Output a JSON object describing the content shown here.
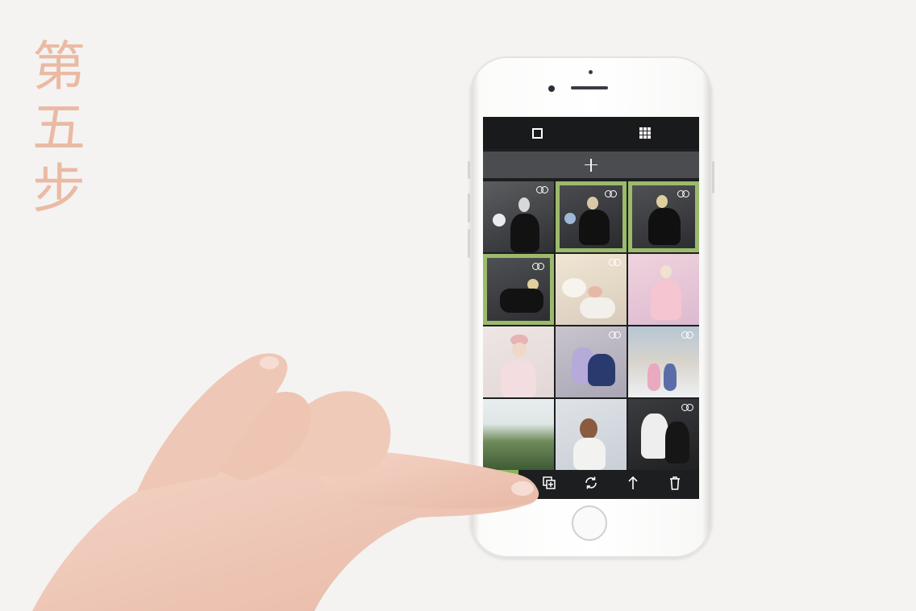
{
  "step_label": [
    "第",
    "五",
    "步"
  ],
  "colors": {
    "background": "#f4f3f1",
    "step_text": "#eabaa4",
    "selection": "#9cba6c",
    "toolbar_accent": "#8db45a"
  },
  "app": {
    "topbar": {
      "left_icon": "single-view-icon",
      "right_icon": "grid-view-icon"
    },
    "addbar_icon": "plus-icon",
    "tiles": [
      {
        "scene": "dark-studio-portrait-with-globe",
        "selected": false,
        "live": true
      },
      {
        "scene": "dark-studio-portrait-with-globe",
        "selected": true,
        "live": true
      },
      {
        "scene": "dark-studio-portrait-sunglasses",
        "selected": true,
        "live": true
      },
      {
        "scene": "dark-studio-portrait-lying",
        "selected": true,
        "live": true
      },
      {
        "scene": "pastel-portrait-lying",
        "selected": false,
        "live": true
      },
      {
        "scene": "pink-pastel-portrait",
        "selected": false,
        "live": false
      },
      {
        "scene": "pastel-portrait-headscarf",
        "selected": false,
        "live": false
      },
      {
        "scene": "couple-portrait-outdoors",
        "selected": false,
        "live": true
      },
      {
        "scene": "snowy-street-couple",
        "selected": false,
        "live": true
      },
      {
        "scene": "green-hills-landscape",
        "selected": false,
        "live": false
      },
      {
        "scene": "windblown-hair-portrait",
        "selected": false,
        "live": false
      },
      {
        "scene": "dancing-couple",
        "selected": false,
        "live": true
      }
    ],
    "toolbar": [
      {
        "icon": "select-check-icon"
      },
      {
        "icon": "duplicate-icon"
      },
      {
        "icon": "refresh-icon"
      },
      {
        "icon": "share-arrow-icon"
      },
      {
        "icon": "trash-icon"
      }
    ]
  }
}
